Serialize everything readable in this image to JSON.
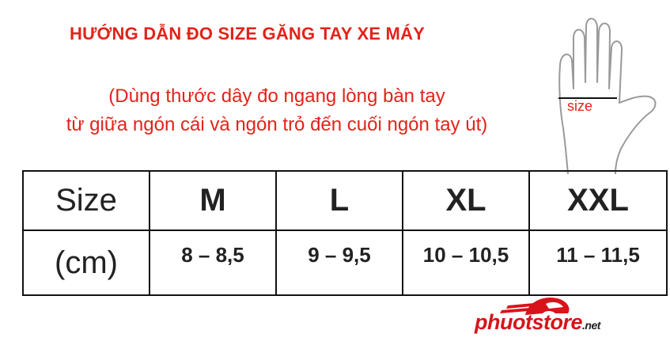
{
  "title": "HƯỚNG DẪN ĐO SIZE GĂNG TAY XE MÁY",
  "subtitle_lines": [
    "(Dùng thước dây đo ngang lòng bàn tay",
    "từ giữa ngón cái và ngón trỏ đến cuối ngón tay út)"
  ],
  "hand_label": "size",
  "table": {
    "header_label": "Size",
    "unit_label": "(cm)",
    "sizes": [
      {
        "name": "M",
        "range": "8 – 8,5"
      },
      {
        "name": "L",
        "range": "9 – 9,5"
      },
      {
        "name": "XL",
        "range": "10 – 10,5"
      },
      {
        "name": "XXL",
        "range": "11 – 11,5"
      }
    ]
  },
  "logo": {
    "brand": "phuotstore",
    "suffix": ".net"
  },
  "colors": {
    "accent": "#e2231a",
    "text": "#222222",
    "border": "#111111"
  }
}
